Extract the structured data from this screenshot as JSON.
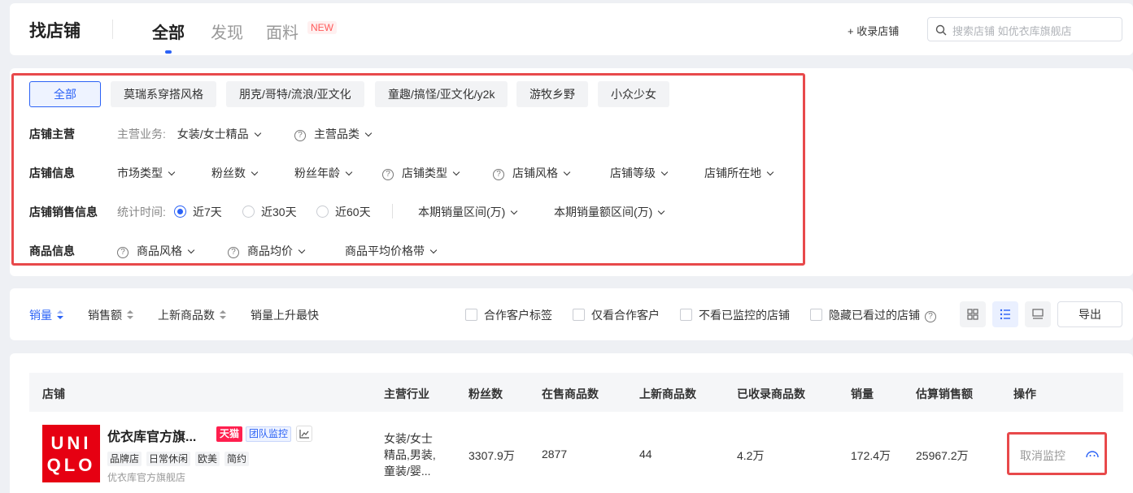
{
  "header": {
    "title": "找店铺",
    "tabs": [
      {
        "label": "全部"
      },
      {
        "label": "发现"
      },
      {
        "label": "面料"
      }
    ],
    "new_badge": "NEW",
    "add_store": "+ 收录店铺",
    "search_placeholder": "搜索店铺 如优衣库旗舰店"
  },
  "filters": {
    "chips": [
      "全部",
      "莫瑞系穿搭风格",
      "朋克/哥特/流浪/亚文化",
      "童趣/搞怪/亚文化/y2k",
      "游牧乡野",
      "小众少女"
    ],
    "main_business": {
      "label": "店铺主营",
      "business_prefix": "主营业务:",
      "business_value": "女装/女士精品",
      "category": "主营品类"
    },
    "store_info": {
      "label": "店铺信息",
      "items": [
        "市场类型",
        "粉丝数",
        "粉丝年龄",
        "店铺类型",
        "店铺风格",
        "店铺等级",
        "店铺所在地"
      ]
    },
    "sales_info": {
      "label": "店铺销售信息",
      "period_label": "统计时间:",
      "periods": [
        "近7天",
        "近30天",
        "近60天"
      ],
      "ranges": [
        "本期销量区间(万)",
        "本期销量额区间(万)"
      ]
    },
    "product_info": {
      "label": "商品信息",
      "items": [
        "商品风格",
        "商品均价",
        "商品平均价格带"
      ]
    }
  },
  "sortbar": {
    "sorts": [
      "销量",
      "销售额",
      "上新商品数",
      "销量上升最快"
    ],
    "checkboxes": [
      "合作客户标签",
      "仅看合作客户",
      "不看已监控的店铺",
      "隐藏已看过的店铺"
    ],
    "help_icon": "?",
    "export": "导出"
  },
  "table": {
    "columns": [
      "店铺",
      "主营行业",
      "粉丝数",
      "在售商品数",
      "上新商品数",
      "已收录商品数",
      "销量",
      "估算销售额",
      "操作"
    ],
    "rows": [
      {
        "logo_line1": "UNI",
        "logo_line2": "QLO",
        "name": "优衣库官方旗...",
        "badge_tmall": "天猫",
        "badge_team": "团队监控",
        "tags": [
          "品牌店",
          "日常休闲",
          "欧美",
          "简约"
        ],
        "subtitle": "优衣库官方旗舰店",
        "industry": "女装/女士精品,男装,童装/婴...",
        "fans": "3307.9万",
        "on_sale": "2877",
        "new_items": "44",
        "collected": "4.2万",
        "sales": "172.4万",
        "est_revenue": "25967.2万",
        "action": "取消监控"
      }
    ]
  },
  "colors": {
    "accent": "#2b62f6",
    "highlight_box": "#e8494b",
    "tmall": "#ff1f4e",
    "uniqlo": "#e60012"
  }
}
